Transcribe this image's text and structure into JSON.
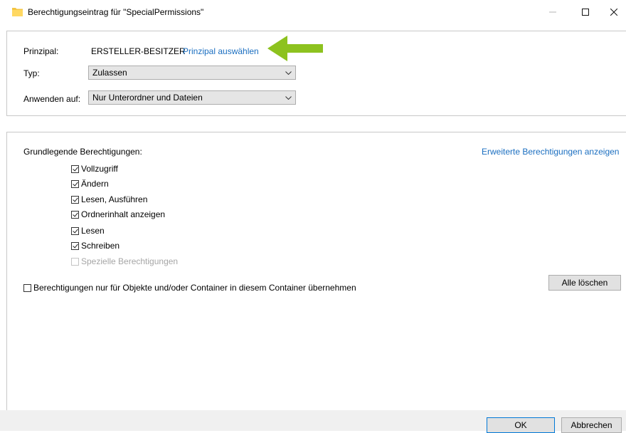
{
  "window": {
    "title": "Berechtigungseintrag für \"SpecialPermissions\"",
    "icon": "folder-icon",
    "controls": [
      "minimize-icon",
      "maximize-icon",
      "close-icon"
    ]
  },
  "principal": {
    "label": "Prinzipal:",
    "value": "ERSTELLER-BESITZER",
    "link": "Prinzipal auswählen"
  },
  "type": {
    "label": "Typ:",
    "selected": "Zulassen"
  },
  "apply_to": {
    "label": "Anwenden auf:",
    "selected": "Nur Unterordner und Dateien"
  },
  "permissions": {
    "heading": "Grundlegende Berechtigungen:",
    "advanced_link": "Erweiterte Berechtigungen anzeigen",
    "items": [
      {
        "label": "Vollzugriff",
        "checked": true,
        "enabled": true
      },
      {
        "label": "Ändern",
        "checked": true,
        "enabled": true
      },
      {
        "label": "Lesen, Ausführen",
        "checked": true,
        "enabled": true
      },
      {
        "label": "Ordnerinhalt anzeigen",
        "checked": true,
        "enabled": true
      },
      {
        "label": "Lesen",
        "checked": true,
        "enabled": true
      },
      {
        "label": "Schreiben",
        "checked": true,
        "enabled": true
      },
      {
        "label": "Spezielle Berechtigungen",
        "checked": false,
        "enabled": false
      }
    ],
    "inherit_only": {
      "label": "Berechtigungen nur für Objekte und/oder Container in diesem Container übernehmen",
      "checked": false
    },
    "clear_all": "Alle löschen"
  },
  "footer": {
    "ok": "OK",
    "cancel": "Abbrechen"
  },
  "colors": {
    "link": "#1a6ec0",
    "annotation_arrow": "#8dc21f",
    "focus_border": "#0078d7"
  }
}
